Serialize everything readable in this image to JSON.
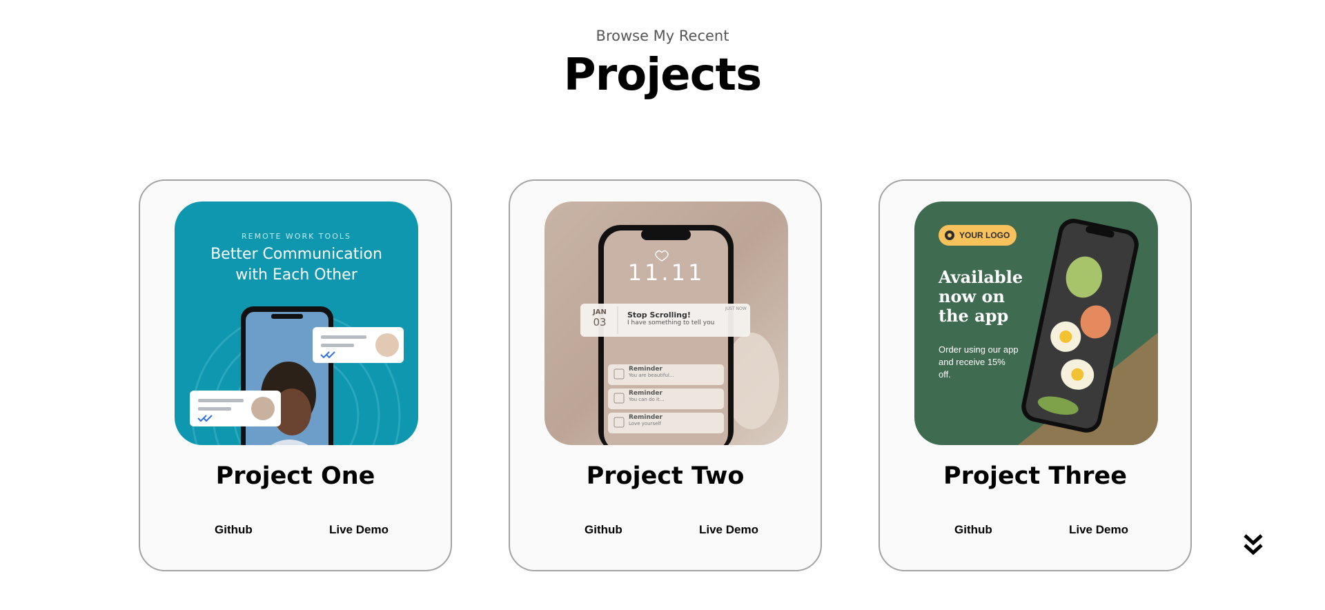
{
  "header": {
    "subtitle": "Browse My Recent",
    "title": "Projects"
  },
  "projects": [
    {
      "title": "Project One",
      "github_label": "Github",
      "demo_label": "Live Demo",
      "thumbnail": {
        "kicker": "REMOTE WORK TOOLS",
        "headline_line1": "Better Communication",
        "headline_line2": "with Each Other"
      }
    },
    {
      "title": "Project Two",
      "github_label": "Github",
      "demo_label": "Live Demo",
      "thumbnail": {
        "clock": "11.11",
        "notif_month": "JAN",
        "notif_day": "03",
        "notif_title": "Stop Scrolling!",
        "notif_text": "I have something to tell you",
        "notif_time": "JUST NOW",
        "reminders": [
          {
            "title": "Reminder",
            "text": "You are beautiful..."
          },
          {
            "title": "Reminder",
            "text": "You can do it..."
          },
          {
            "title": "Reminder",
            "text": "Love yourself"
          }
        ]
      }
    },
    {
      "title": "Project Three",
      "github_label": "Github",
      "demo_label": "Live Demo",
      "thumbnail": {
        "logo": "YOUR LOGO",
        "headline_line1": "Available",
        "headline_line2": "now on",
        "headline_line3": "the app",
        "body": "Order using our app and receive 15% off."
      }
    }
  ],
  "colors": {
    "card_border": "#a3a3a3",
    "card_bg": "#fafafa",
    "thumb1_bg": "#0f97b0",
    "thumb3_bg": "#3f6b51",
    "logo_pill": "#f7c15b"
  },
  "icons": {
    "scroll": "double-chevron-down-icon"
  }
}
